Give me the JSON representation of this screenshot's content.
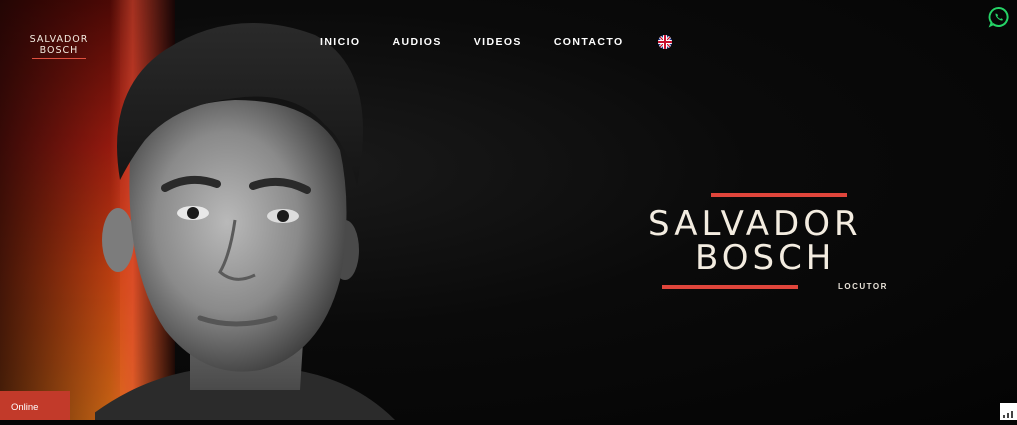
{
  "logo": {
    "line1": "SALVADOR",
    "line2": "BOSCH"
  },
  "nav": {
    "items": [
      {
        "label": "INICIO"
      },
      {
        "label": "AUDIOS"
      },
      {
        "label": "VIDEOS"
      },
      {
        "label": "CONTACTO"
      }
    ],
    "language_icon": "uk-flag-icon"
  },
  "whatsapp_icon": "whatsapp-icon",
  "hero": {
    "title_line1": "SALVADOR",
    "title_line2": "BOSCH",
    "subtitle": "LOCUTOR",
    "accent_color": "#e0453b"
  },
  "chat_widget": {
    "label": "Online",
    "color": "#c23a2a"
  }
}
